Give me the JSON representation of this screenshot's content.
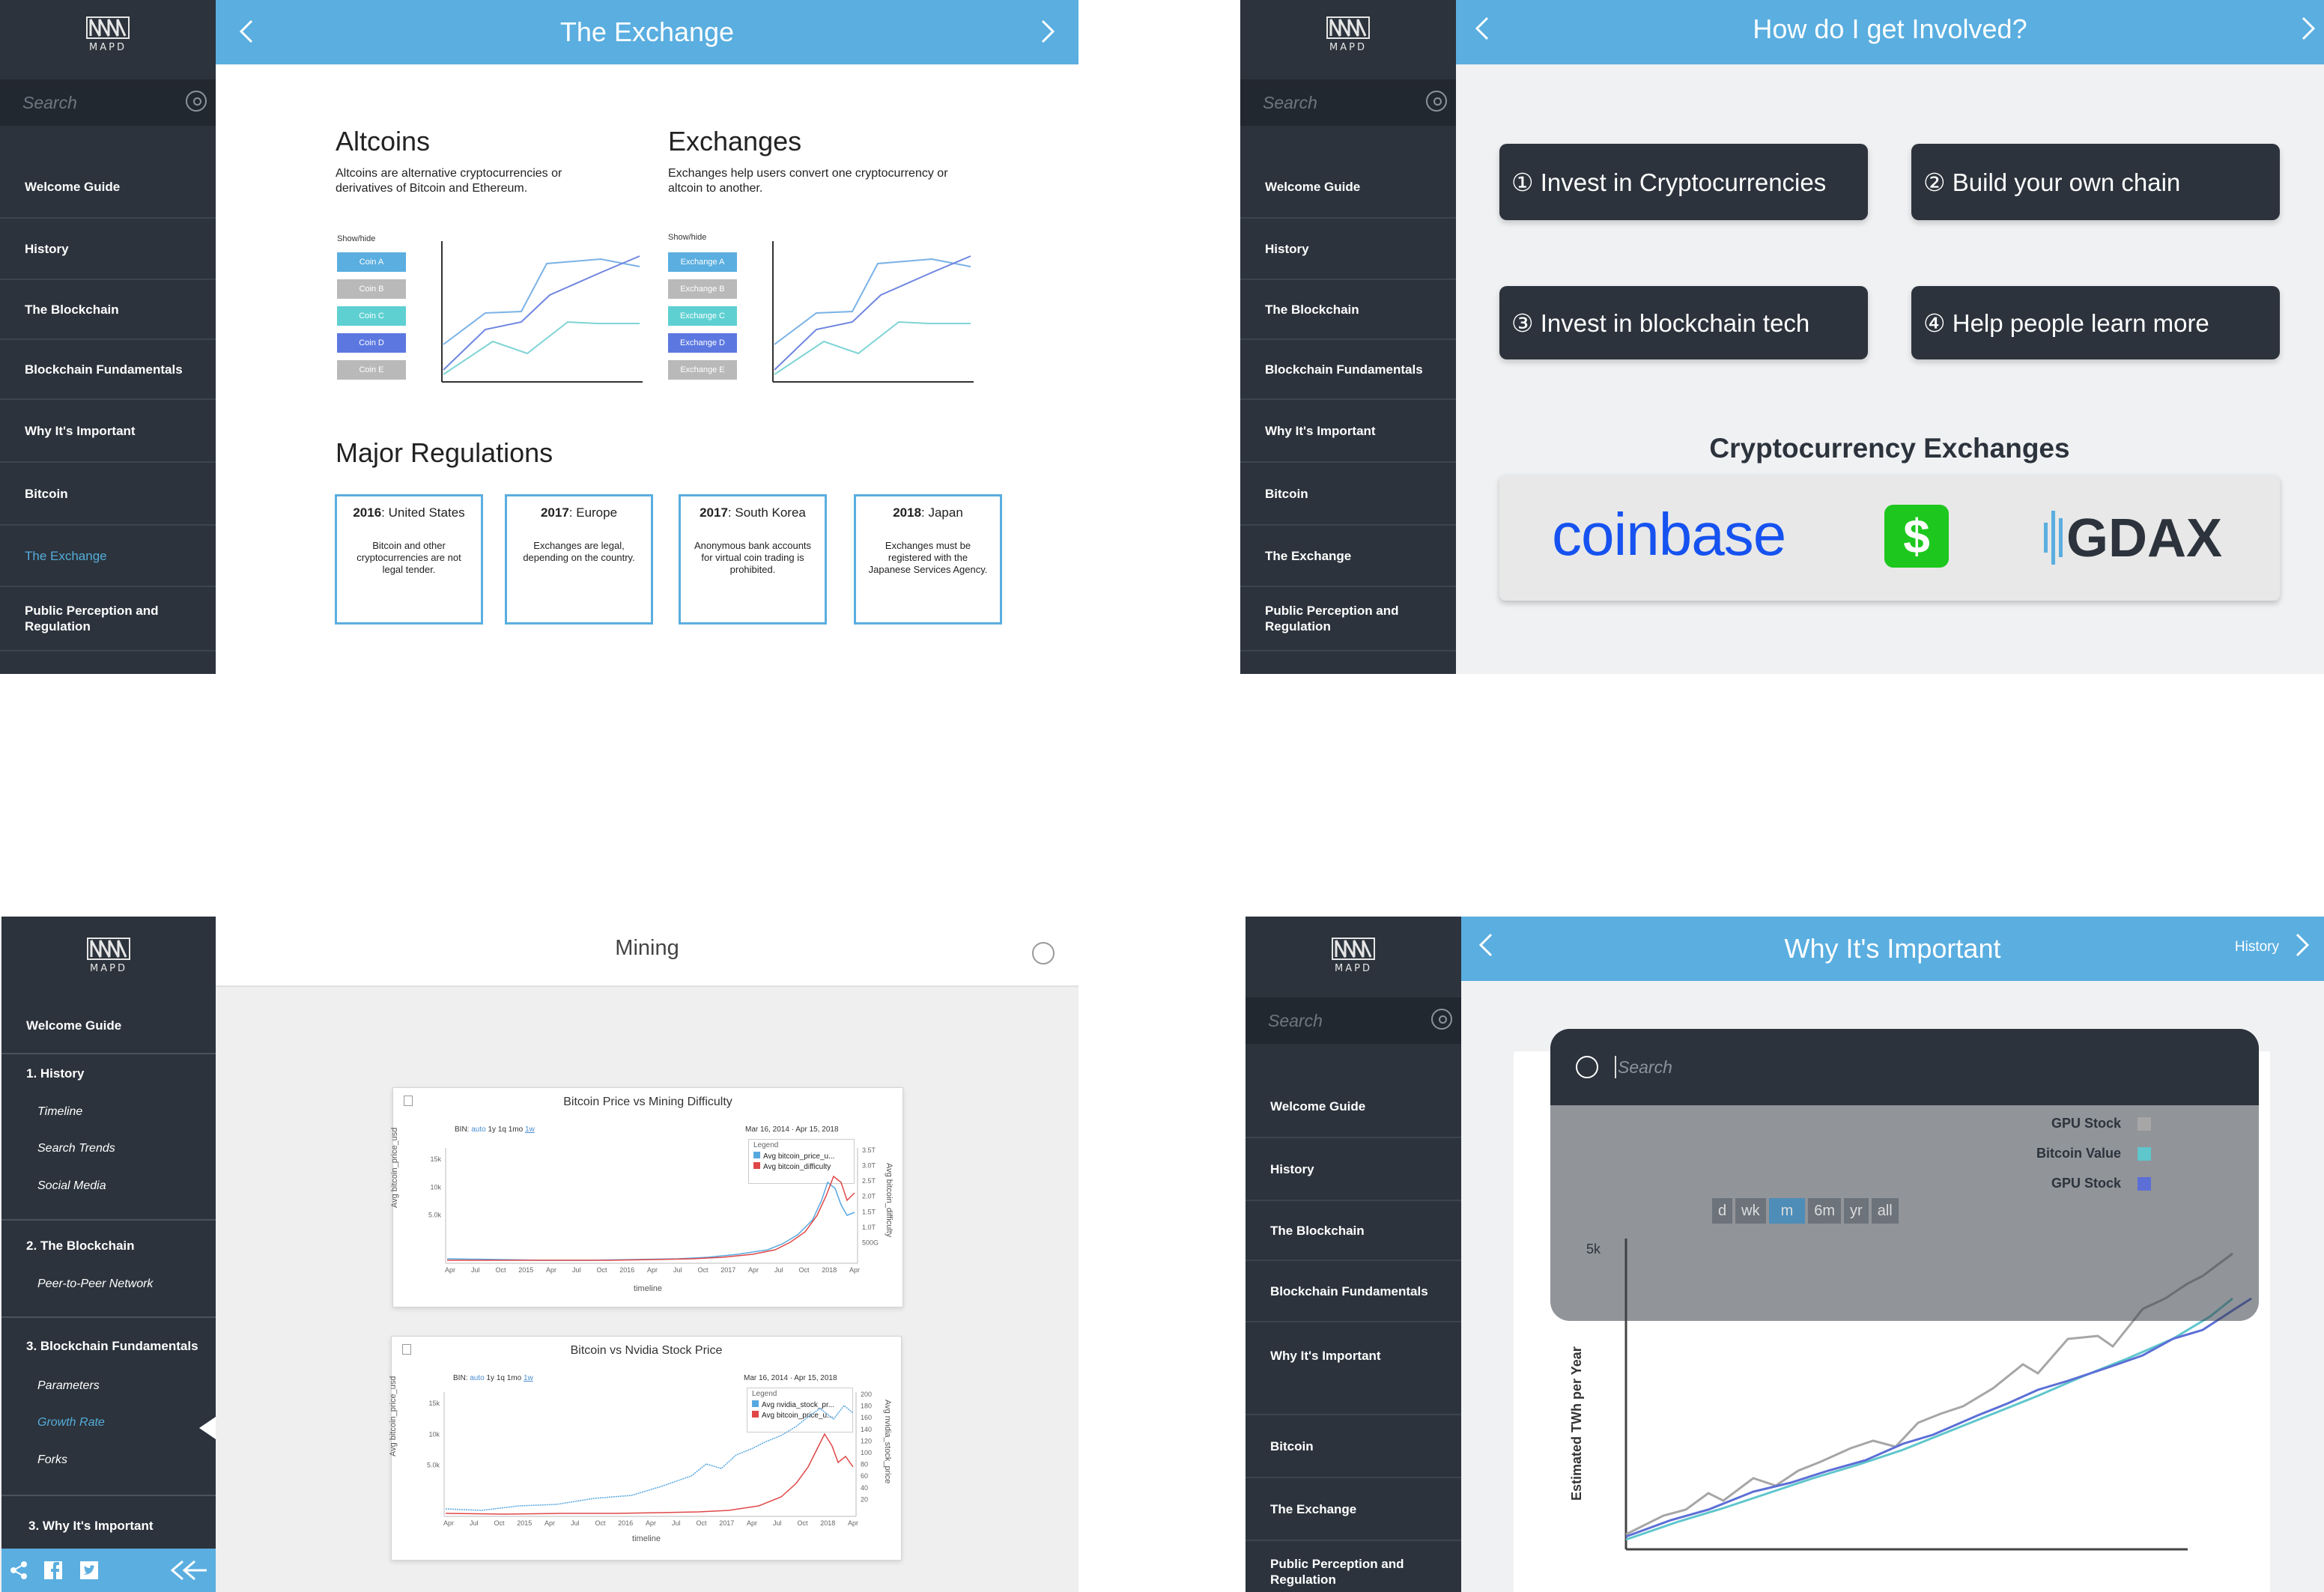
{
  "brand": {
    "logo_text": "MAPD",
    "accent": "#5aaee0",
    "sidebar_bg": "#2c333c"
  },
  "panel1": {
    "sidebar": {
      "search_placeholder": "Search",
      "items": [
        "Welcome Guide",
        "History",
        "The Blockchain",
        "Blockchain Fundamentals",
        "Why It's Important",
        "Bitcoin",
        "The Exchange",
        "Public Perception and Regulation"
      ],
      "active_item": "The Exchange"
    },
    "title": "The Exchange",
    "altcoins": {
      "heading": "Altcoins",
      "description": "Altcoins are alternative cryptocurrencies or derivatives of Bitcoin and Ethereum.",
      "showhide": "Show/hide",
      "chips": [
        "Coin A",
        "Coin B",
        "Coin C",
        "Coin D",
        "Coin E"
      ]
    },
    "exchanges": {
      "heading": "Exchanges",
      "description": "Exchanges help users convert one cryptocurrency or altcoin to another.",
      "showhide": "Show/hide",
      "chips": [
        "Exchange A",
        "Exchange B",
        "Exchange C",
        "Exchange D",
        "Exchange E"
      ]
    },
    "chip_colors": [
      "#5aaee0",
      "#b9b9b9",
      "#5fd0d2",
      "#5c78e0",
      "#b9b9b9"
    ],
    "regulations": {
      "heading": "Major Regulations",
      "items": [
        {
          "year": "2016",
          "place": ": United States",
          "text": "Bitcoin and other cryptocurrencies are not legal tender."
        },
        {
          "year": "2017",
          "place": ": Europe",
          "text": "Exchanges are legal, depending on the country."
        },
        {
          "year": "2017",
          "place": ": South Korea",
          "text": "Anonymous bank accounts for virtual coin trading is prohibited."
        },
        {
          "year": "2018",
          "place": ": Japan",
          "text": "Exchanges must be registered with the Japanese Services Agency."
        }
      ]
    }
  },
  "panel2": {
    "sidebar": {
      "search_placeholder": "Search",
      "items": [
        "Welcome Guide",
        "History",
        "The Blockchain",
        "Blockchain Fundamentals",
        "Why It's Important",
        "Bitcoin",
        "The Exchange",
        "Public Perception and Regulation"
      ]
    },
    "title": "How do I get Involved?",
    "options": [
      "① Invest in Cryptocurrencies",
      "② Build your own chain",
      "③ Invest in blockchain tech",
      "④ Help people learn more"
    ],
    "exchanges_heading": "Cryptocurrency Exchanges",
    "exchange_logos": [
      "coinbase",
      "$",
      "GDAX"
    ],
    "logo_colors": {
      "coinbase": "#1652f0",
      "cash": "#1ec71e",
      "gdax": "#2c333c"
    }
  },
  "panel3": {
    "sidebar": {
      "welcome": "Welcome Guide",
      "sections": [
        {
          "label": "1. History",
          "subs": [
            "Timeline",
            "Search Trends",
            "Social Media"
          ]
        },
        {
          "label": "2. The Blockchain",
          "subs": [
            "Peer-to-Peer Network"
          ]
        },
        {
          "label": "3. Blockchain Fundamentals",
          "subs": [
            "Parameters",
            "Growth Rate",
            "Forks"
          ]
        },
        {
          "label": "3. Why It's Important",
          "subs": []
        }
      ],
      "active_sub": "Growth Rate"
    },
    "title": "Mining",
    "charts": [
      {
        "title": "Bitcoin Price vs Mining Difficulty",
        "bin_label": "BIN:",
        "bins": [
          "auto",
          "1y",
          "1q",
          "1mo",
          "1w"
        ],
        "date_range": "Mar 16, 2014 · Apr 15, 2018",
        "legend_title": "Legend",
        "legend": [
          "Avg bitcoin_price_u...",
          "Avg bitcoin_difficulty"
        ],
        "y_label": "Avg bitcoin_price_usd",
        "y2_label": "Avg bitcoin_difficulty",
        "x_label": "timeline",
        "y_ticks": [
          "15k",
          "10k",
          "5.0k"
        ],
        "y2_ticks": [
          "3.5T",
          "3.0T",
          "2.5T",
          "2.0T",
          "1.5T",
          "1.0T",
          "500G"
        ],
        "x_ticks": [
          "Apr",
          "Jul",
          "Oct",
          "2015",
          "Apr",
          "Jul",
          "Oct",
          "2016",
          "Apr",
          "Jul",
          "Oct",
          "2017",
          "Apr",
          "Jul",
          "Oct",
          "2018",
          "Apr"
        ]
      },
      {
        "title": "Bitcoin vs Nvidia Stock Price",
        "bin_label": "BIN:",
        "bins": [
          "auto",
          "1y",
          "1q",
          "1mo",
          "1w"
        ],
        "date_range": "Mar 16, 2014 · Apr 15, 2018",
        "legend_title": "Legend",
        "legend": [
          "Avg nvidia_stock_pr...",
          "Avg bitcoin_price_u..."
        ],
        "y_label": "Avg bitcoin_price_usd",
        "y2_label": "Avg nvidia_stock_price",
        "x_label": "timeline",
        "y_ticks": [
          "15k",
          "10k",
          "5.0k"
        ],
        "y2_ticks": [
          "200",
          "180",
          "160",
          "140",
          "120",
          "100",
          "80",
          "60",
          "40",
          "20"
        ],
        "x_ticks": [
          "Apr",
          "Jul",
          "Oct",
          "2015",
          "Apr",
          "Jul",
          "Oct",
          "2016",
          "Apr",
          "Jul",
          "Oct",
          "2017",
          "Apr",
          "Jul",
          "Oct",
          "2018",
          "Apr"
        ]
      }
    ]
  },
  "panel4": {
    "sidebar": {
      "search_placeholder": "Search",
      "items": [
        "Welcome Guide",
        "History",
        "The Blockchain",
        "Blockchain Fundamentals",
        "Why It's Important",
        "Bitcoin",
        "The Exchange",
        "Public Perception and Regulation"
      ]
    },
    "title": "Why It's Important",
    "next_label": "History",
    "search_placeholder": "Search",
    "legend": [
      "GPU Stock",
      "Bitcoin Value",
      "GPU Stock"
    ],
    "legend_colors": [
      "#a6a6a6",
      "#5fc6cc",
      "#5c6fd6"
    ],
    "range_buttons": [
      "d",
      "wk",
      "m",
      "6m",
      "yr",
      "all"
    ],
    "active_range": "m",
    "y_axis_label": "Estimated TWh per Year",
    "y_tick": "5k"
  }
}
